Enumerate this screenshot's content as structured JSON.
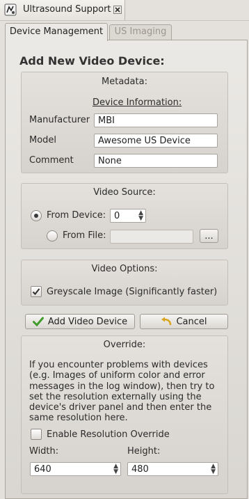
{
  "window": {
    "title": "Ultrasound Support",
    "app_icon": "ultrasound-app-icon",
    "close_icon": "close-icon"
  },
  "tabs": [
    {
      "label": "Device Management",
      "active": true
    },
    {
      "label": "US Imaging",
      "active": false
    }
  ],
  "page": {
    "heading": "Add New Video Device:"
  },
  "metadata": {
    "title": "Metadata:",
    "section_label": "Device Information:",
    "manufacturer_label": "Manufacturer",
    "manufacturer_value": "MBI",
    "model_label": "Model",
    "model_value": "Awesome US Device",
    "comment_label": "Comment",
    "comment_value": "None"
  },
  "video_source": {
    "title": "Video Source:",
    "from_device_label": "From Device:",
    "from_device_selected": true,
    "device_index": "0",
    "from_file_label": "From File:",
    "file_path": "",
    "browse_label": "..."
  },
  "video_options": {
    "title": "Video Options:",
    "greyscale_label": "Greyscale Image (Significantly faster)",
    "greyscale_checked": true
  },
  "actions": {
    "add_label": "Add Video Device",
    "add_icon": "checkmark-icon",
    "cancel_label": "Cancel",
    "cancel_icon": "undo-arrow-icon"
  },
  "override": {
    "title": "Override:",
    "help_lines": [
      "If you encounter problems with devices",
      "(e.g. Images of uniform color and error",
      "messages in the log window), then try to",
      "set the resolution externally using the",
      "device's driver panel and then enter the",
      "same resolution here."
    ],
    "enable_label": "Enable Resolution Override",
    "enable_checked": false,
    "width_label": "Width:",
    "width_value": "640",
    "height_label": "Height:",
    "height_value": "480"
  },
  "colors": {
    "background": "#e4e1dc",
    "check_green": "#3f9b2a",
    "undo_yellow": "#d9a520"
  }
}
